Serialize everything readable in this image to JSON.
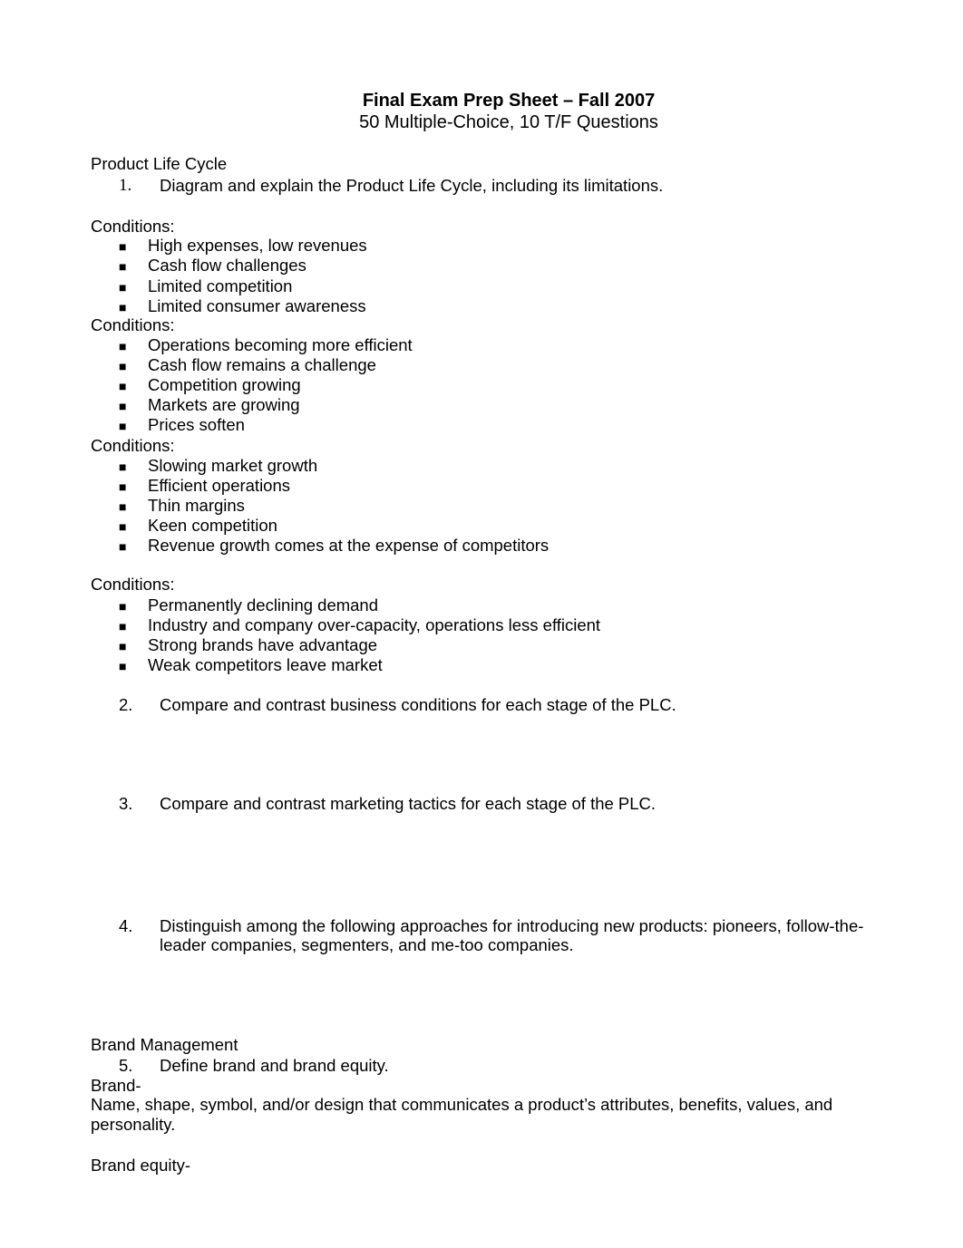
{
  "header": {
    "title": "Final Exam Prep Sheet – Fall 2007",
    "subtitle": "50 Multiple-Choice, 10 T/F Questions"
  },
  "sections": {
    "plc": {
      "heading": "Product Life Cycle",
      "q1": {
        "number": "1.",
        "text": "Diagram and explain the Product Life Cycle, including its limitations."
      },
      "conditions_label": "Conditions:",
      "bullet_glyph": "■",
      "group1": [
        "High expenses, low revenues",
        "Cash flow challenges",
        "Limited competition",
        "Limited consumer awareness"
      ],
      "group2": [
        "Operations becoming more efficient",
        "Cash flow remains a challenge",
        "Competition growing",
        "Markets are growing",
        "Prices soften"
      ],
      "group3": [
        "Slowing market growth",
        "Efficient operations",
        "Thin margins",
        "Keen competition",
        "Revenue growth comes at the expense of competitors"
      ],
      "group4": [
        "Permanently declining demand",
        "Industry and company over-capacity, operations less efficient",
        "Strong brands have advantage",
        "Weak competitors leave market"
      ],
      "q2": {
        "number": "2.",
        "text": "Compare and contrast business conditions for each stage of the PLC."
      },
      "q3": {
        "number": "3.",
        "text": "Compare and contrast marketing tactics for each stage of the PLC."
      },
      "q4": {
        "number": "4.",
        "line1": "Distinguish among the following approaches for introducing new products: pioneers, follow-the-",
        "line2": "leader companies, segmenters, and me-too companies."
      }
    },
    "brand": {
      "heading": "Brand Management",
      "q5": {
        "number": "5.",
        "text": "Define brand and brand equity."
      },
      "brand_label": "Brand-",
      "brand_def_line1": "Name, shape, symbol, and/or design that communicates a product’s attributes, benefits, values, and",
      "brand_def_line2": "personality.",
      "equity_label": "Brand equity-"
    }
  }
}
